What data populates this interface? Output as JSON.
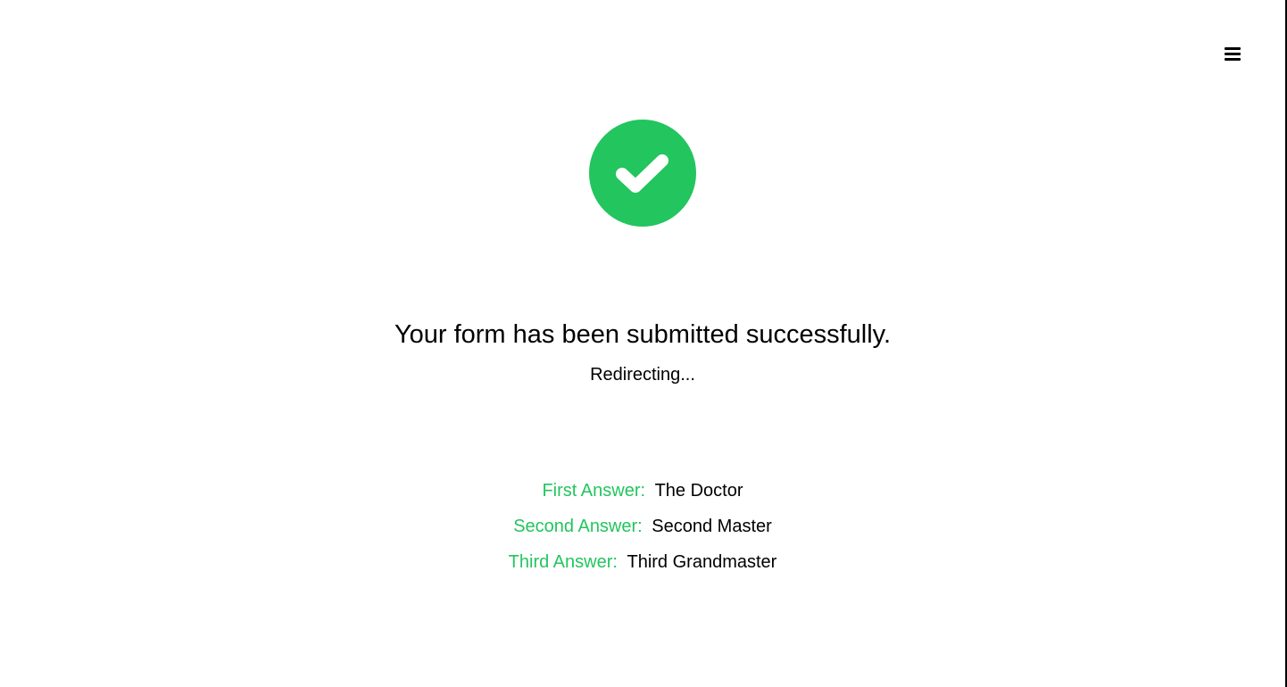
{
  "colors": {
    "accent": "#22c55e",
    "text": "#000000",
    "background": "#ffffff"
  },
  "header": {
    "menu_icon": "hamburger-menu-icon"
  },
  "status": {
    "icon": "check-circle-icon",
    "title": "Your form has been submitted successfully.",
    "subtitle": "Redirecting..."
  },
  "answers": [
    {
      "label": "First Answer:",
      "value": "The Doctor"
    },
    {
      "label": "Second Answer:",
      "value": "Second Master"
    },
    {
      "label": "Third Answer:",
      "value": "Third Grandmaster"
    }
  ]
}
